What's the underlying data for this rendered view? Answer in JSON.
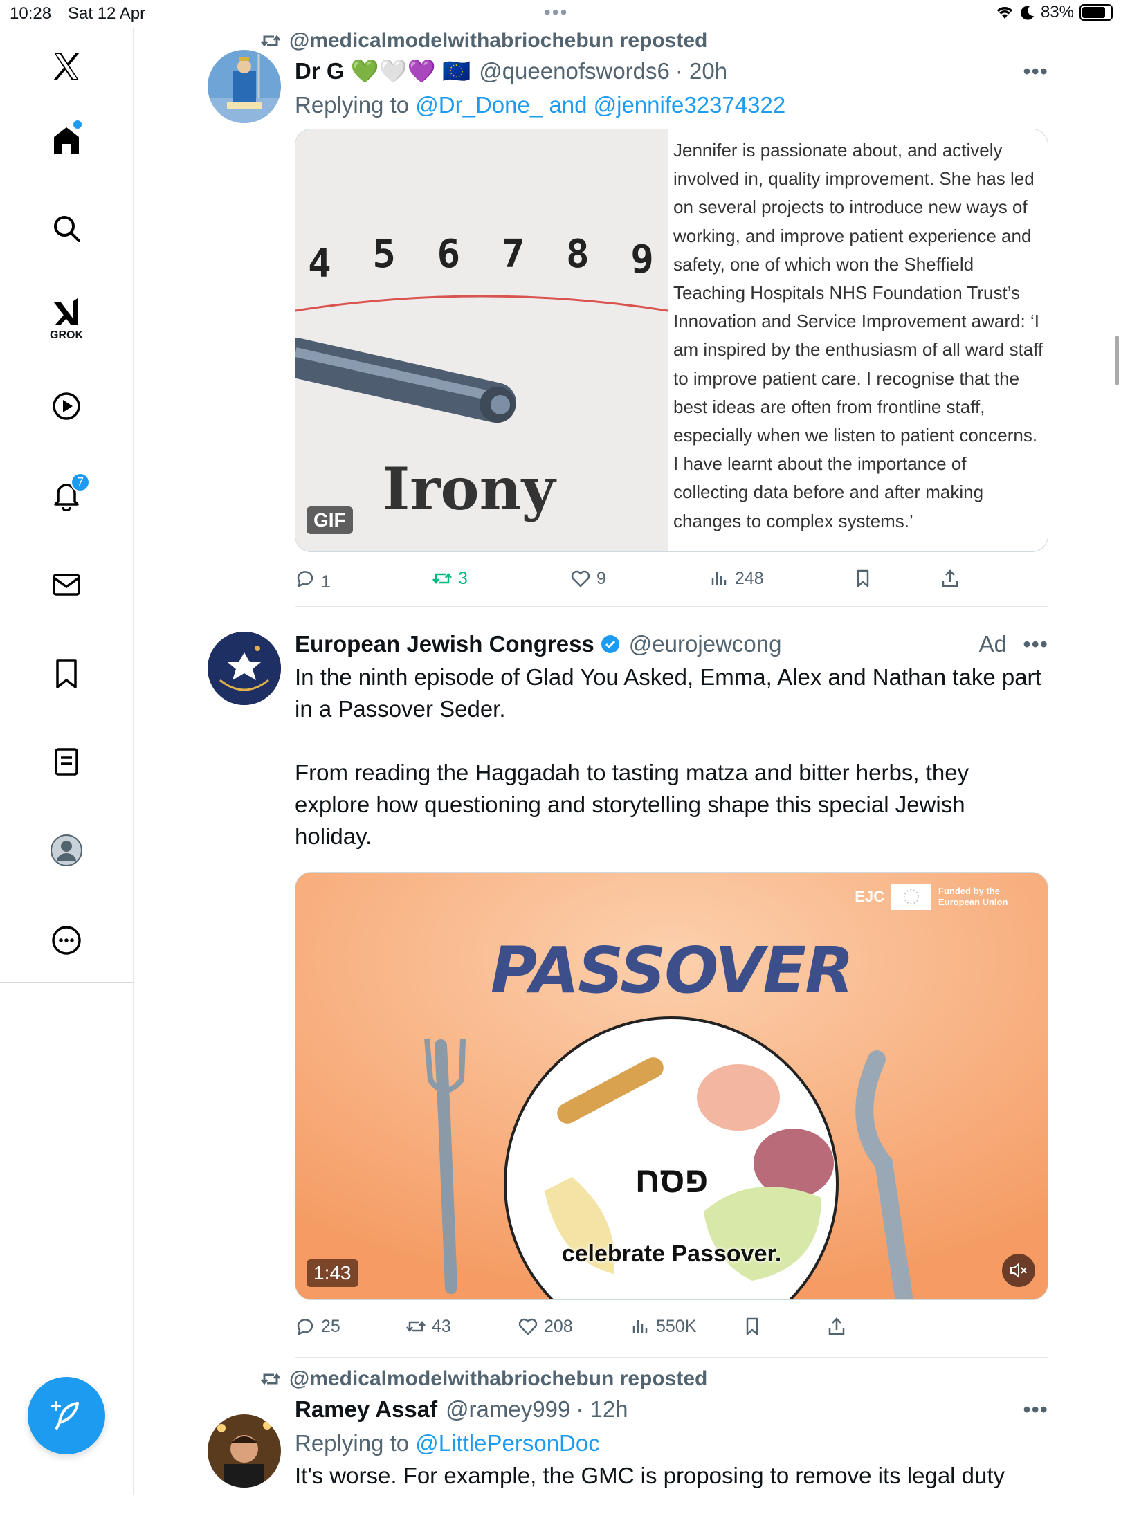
{
  "status_bar": {
    "time": "10:28",
    "date": "Sat 12 Apr",
    "battery": "83%",
    "battery_level": 0.83
  },
  "sidebar": {
    "grok_label": "GROK",
    "notifications_count": "7"
  },
  "tweets": [
    {
      "repost_label": "@medicalmodelwithabriochebun reposted",
      "name": "Dr G 💚🤍💜 🇪🇺",
      "handle": "@queenofswords6",
      "time": "· 20h",
      "replying_prefix": "Replying to",
      "replying_to_1": "@Dr_Done_",
      "replying_and": "and",
      "replying_to_2": "@jennife32374322",
      "gif": {
        "dial_numbers": [
          "4",
          "5",
          "6",
          "7",
          "8",
          "9"
        ],
        "word": "Irony",
        "badge": "GIF"
      },
      "quote_text": "Jennifer is passionate about, and actively involved in, quality improvement. She has led on several projects to introduce new ways of working, and improve patient experience and safety, one of which won the Sheffield Teaching Hospitals NHS Foundation Trust’s Innovation and Service Improvement award: ‘I am inspired by the enthusiasm of all ward staff to improve patient care. I recognise that the best ideas are often from frontline staff, especially when we listen to patient concerns. I have learnt about the importance of collecting data before and after making changes to complex systems.’",
      "stats": {
        "replies": "1",
        "reposts": "3",
        "likes": "9",
        "views": "248"
      }
    },
    {
      "name": "European Jewish Congress",
      "handle": "@eurojewcong",
      "ad_label": "Ad",
      "text_1": "In the ninth episode of Glad You Asked, Emma, Alex and Nathan take part in a Passover Seder.",
      "text_2": "From reading the Haggadah to tasting matza and bitter herbs, they explore how questioning and storytelling shape this special Jewish holiday.",
      "video": {
        "title": "PASSOVER",
        "hebrew": "פסח",
        "subtitle": "celebrate Passover.",
        "duration": "1:43",
        "ejc_logo": "EJC",
        "funded_by": "Funded by the European Union"
      },
      "stats": {
        "replies": "25",
        "reposts": "43",
        "likes": "208",
        "views": "550K"
      }
    },
    {
      "repost_label": "@medicalmodelwithabriochebun reposted",
      "name": "Ramey Assaf",
      "handle": "@ramey999",
      "time": "· 12h",
      "replying_prefix": "Replying to",
      "replying_to_1": "@LittlePersonDoc",
      "text": "It's worse. For example, the GMC is proposing to remove its legal duty"
    }
  ],
  "colors": {
    "accent": "#1d9bf0",
    "repost_green": "#00ba7c",
    "text_secondary": "#536471",
    "video_bg": "#f7a873"
  }
}
